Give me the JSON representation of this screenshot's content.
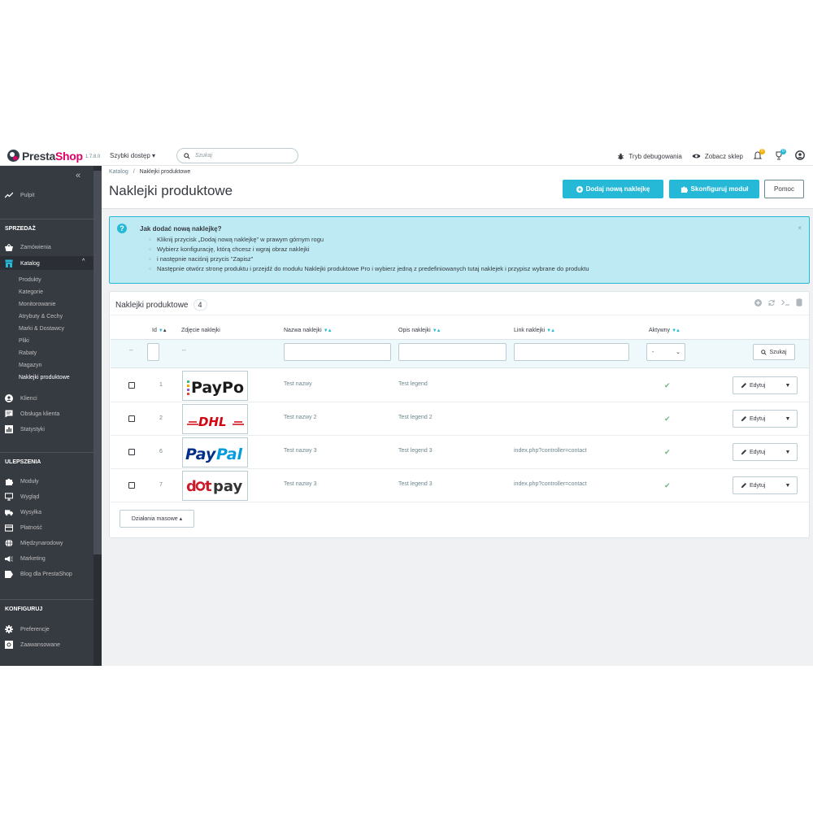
{
  "header": {
    "logo_prefix": "Presta",
    "logo_suffix": "Shop",
    "version": "1.7.8.0",
    "quick_access": "Szybki dostęp ▾",
    "search_placeholder": "Szukaj",
    "debug_mode": "Tryb debugowania",
    "view_shop": "Zobacz sklep",
    "notif_orders_count": "0",
    "notif_customers_count": "0"
  },
  "sidebar": {
    "collapse": "«",
    "dashboard": "Pulpit",
    "section_sales": "SPRZEDAŻ",
    "orders": "Zamówienia",
    "catalog": "Katalog",
    "catalog_sub": [
      "Produkty",
      "Kategorie",
      "Monitorowanie",
      "Atrybuty & Cechy",
      "Marki & Dostawcy",
      "Pliki",
      "Rabaty",
      "Magazyn",
      "Naklejki produktowe"
    ],
    "customers": "Klienci",
    "customer_service": "Obsługa klienta",
    "stats": "Statystyki",
    "section_improve": "ULEPSZENIA",
    "modules": "Moduły",
    "design": "Wygląd",
    "shipping": "Wysyłka",
    "payment": "Płatność",
    "international": "Międzynarodowy",
    "marketing": "Marketing",
    "blog": "Blog dla PrestaShop",
    "section_configure": "KONFIGURUJ",
    "preferences": "Preferencje",
    "advanced": "Zaawansowane"
  },
  "toolbar": {
    "breadcrumb_parent": "Katalog",
    "breadcrumb_sep": "/",
    "breadcrumb_current": "Naklejki produktowe",
    "title": "Naklejki produktowe",
    "add_button": "Dodaj nową naklejkę",
    "configure_button": "Skonfiguruj moduł",
    "help_button": "Pomoc"
  },
  "alert": {
    "icon": "?",
    "title": "Jak dodać nową naklejkę?",
    "steps": [
      "Kliknij przycisk „Dodaj nową naklejkę” w prawym górnym rogu",
      "Wybierz konfigurację, którą chcesz i wgraj obraz naklejki",
      "i następnie naciśnij przycis \"Zapisz\"",
      "Następnie otwórz stronę produktu i przejdź do modułu Naklejki produktowe Pro i wybierz jedną z predefiniowanych tutaj naklejek i przypisz wybrane do produktu"
    ],
    "close": "×"
  },
  "panel": {
    "title": "Naklejki produktowe",
    "count": "4",
    "columns": {
      "id": "Id",
      "image": "Zdjęcie naklejki",
      "name": "Nazwa naklejki",
      "desc": "Opis naklejki",
      "link": "Link naklejki",
      "active": "Aktywny"
    },
    "filter_dash": "--",
    "filter_select": "-",
    "search_button": "Szukaj",
    "rows": [
      {
        "id": "1",
        "logo": "PayPo",
        "name": "Test nazwy",
        "desc": "Test legend",
        "link": "",
        "edit": "Edytuj"
      },
      {
        "id": "2",
        "logo": "DHL",
        "name": "Test nazwy 2",
        "desc": "Test legend 2",
        "link": "",
        "edit": "Edytuj"
      },
      {
        "id": "6",
        "logo": "PayPal",
        "name": "Test nazwy 3",
        "desc": "Test legend 3",
        "link": "index.php?controller=contact",
        "edit": "Edytuj"
      },
      {
        "id": "7",
        "logo": "dotpay",
        "name": "Test nazwy 3",
        "desc": "Test legend 3",
        "link": "index.php?controller=contact",
        "edit": "Edytuj"
      }
    ],
    "bulk_actions": "Działania masowe ▴"
  },
  "colors": {
    "accent": "#25b9d7",
    "brand_pink": "#df0067",
    "sidebar_bg": "#363a41",
    "success": "#70b580"
  }
}
